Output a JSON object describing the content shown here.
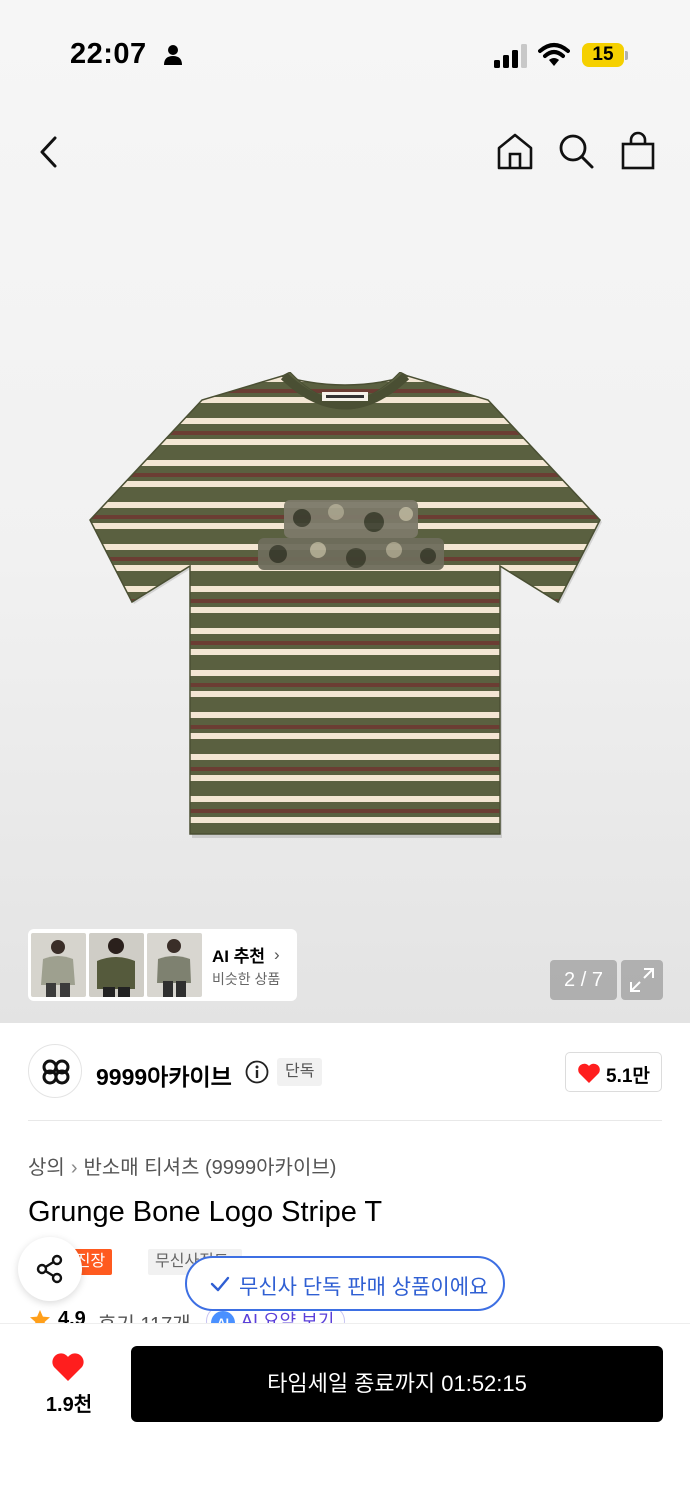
{
  "status_bar": {
    "time": "22:07",
    "battery": "15"
  },
  "nav": {
    "icons": [
      "chevron-left-icon",
      "home-icon",
      "search-icon",
      "shopping-bag-icon"
    ]
  },
  "gallery": {
    "page_indicator": "2 / 7",
    "ai_recommend": {
      "title": "AI 추천",
      "subtitle": "비슷한 상품"
    },
    "product_colors": {
      "shirt_base": "#5a6040",
      "stripe_cream": "#f3e6d3",
      "stripe_brown": "#6b3d33"
    }
  },
  "brand": {
    "name": "9999아카이브",
    "exclusive_tag": "단독",
    "likes": "5.1만"
  },
  "product": {
    "breadcrumb": [
      "상의",
      "반소매 티셔츠 (9999아카이브)"
    ],
    "title": "Grunge Bone Logo Stripe T",
    "badges": {
      "free_shipping": "무진장",
      "direct": "무신사직드"
    },
    "rating": "4.9",
    "review_count": "후기 117개",
    "ai_summary": "AI 요약 보기",
    "ai_summary_badge": "AI"
  },
  "toast": {
    "message": "무신사 단독 판매 상품이에요"
  },
  "bottom_bar": {
    "like_count": "1.9천",
    "buy_label": "타임세일 종료까지 01:52:15"
  },
  "colors": {
    "accent_red": "#ff1e1e",
    "accent_orange": "#ff5a1f",
    "toast_blue": "#3d6fe3"
  }
}
